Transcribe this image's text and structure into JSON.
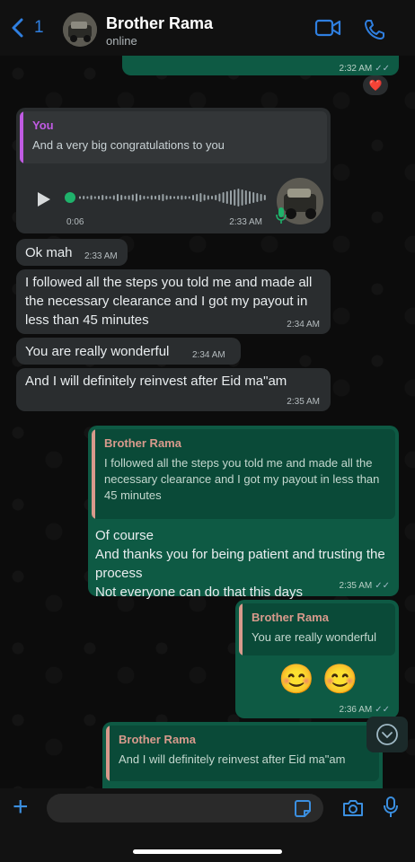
{
  "header": {
    "back_count": "1",
    "contact_name": "Brother Rama",
    "status": "online"
  },
  "colors": {
    "accent": "#2f7fe0",
    "outgoing_bubble": "#0e5a44",
    "incoming_bubble": "#2a2d2f",
    "quote_you": "#c05be3",
    "quote_contact": "#d89a8c"
  },
  "messages": {
    "top_partial": {
      "time": "2:32 AM",
      "reaction": "❤️"
    },
    "voice_reply": {
      "quote_author": "You",
      "quote_text": "And a very big congratulations to you",
      "duration": "0:06",
      "time": "2:33 AM"
    },
    "m1": {
      "text": "Ok mah",
      "time": "2:33 AM"
    },
    "m2": {
      "text": "I followed all the steps you told me and made all the necessary clearance and I got my payout in less than 45 minutes",
      "time": "2:34 AM"
    },
    "m3": {
      "text": "You are really wonderful",
      "time": "2:34 AM"
    },
    "m4": {
      "text": "And I will definitely reinvest after Eid ma\"am",
      "time": "2:35 AM"
    },
    "r1": {
      "quote_author": "Brother Rama",
      "quote_text": "I followed all the steps you told me and made all the necessary clearance and I got my payout in less than 45 minutes",
      "line1": "Of course",
      "line2": "And thanks you for being patient and trusting the process",
      "line3": "Not everyone can do that this days",
      "time": "2:35 AM"
    },
    "r2": {
      "quote_author": "Brother Rama",
      "quote_text": "You are really wonderful",
      "emoji": "😊 😊",
      "time": "2:36 AM"
    },
    "r3": {
      "quote_author": "Brother Rama",
      "quote_text": "And I will definitely reinvest after Eid ma\"am"
    }
  },
  "input": {
    "placeholder": ""
  },
  "icons": [
    "chevron-left-icon",
    "video-call-icon",
    "phone-icon",
    "play-icon",
    "mic-icon",
    "heart-icon",
    "chevron-down-icon",
    "plus-icon",
    "sticker-icon",
    "camera-icon"
  ]
}
